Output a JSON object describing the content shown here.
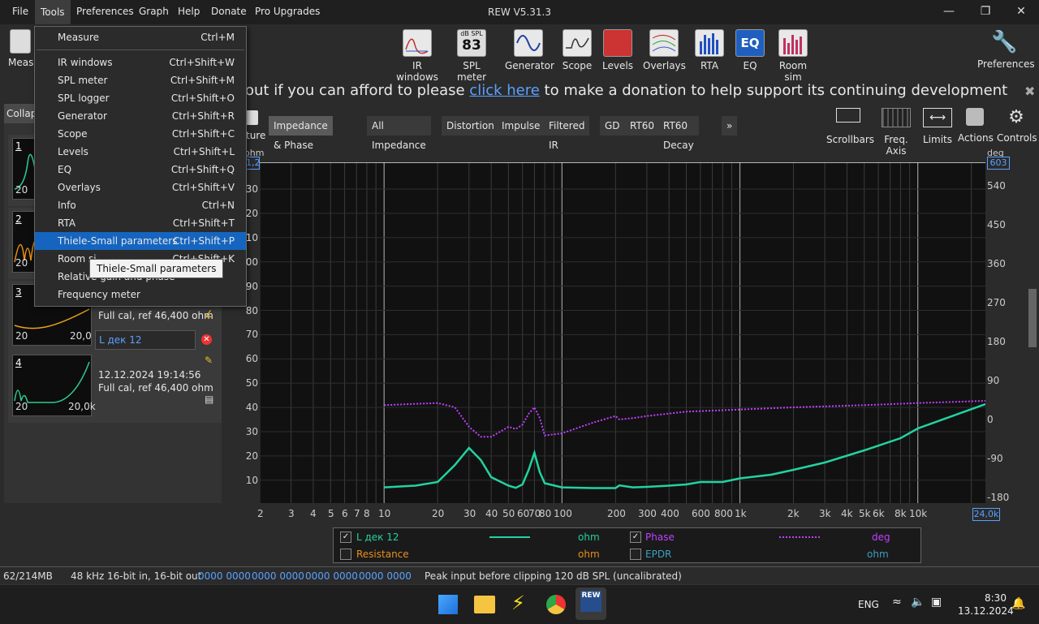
{
  "menubar": {
    "items": [
      "File",
      "Tools",
      "Preferences",
      "Graph",
      "Help",
      "Donate",
      "Pro Upgrades"
    ],
    "title": "REW V5.31.3"
  },
  "toolbar": {
    "left_label": "Meas",
    "buttons": [
      "IR windows",
      "SPL meter",
      "Generator",
      "Scope",
      "Levels",
      "Overlays",
      "RTA",
      "EQ",
      "Room sim"
    ],
    "spl_icon_top": "dB SPL",
    "spl_icon_value": "83",
    "eq_icon_text": "EQ",
    "preferences": "Preferences"
  },
  "donation": {
    "prefix": "out if you can afford to please ",
    "link": "click here",
    "suffix": " to make a donation to help support its continuing development"
  },
  "panel": {
    "collapse_label": "Collap",
    "capture_label": "ture",
    "measurements": [
      {
        "num": "1",
        "x_start": "20",
        "accent": "#2ecc8f"
      },
      {
        "num": "2",
        "x_start": "20",
        "accent": "#e8901a"
      },
      {
        "num": "3",
        "x_start": "20",
        "x_end": "20,0",
        "accent": "#e8a01a",
        "info": "Full cal, ref 46,400 ohm"
      },
      {
        "num": "4",
        "x_start": "20",
        "x_end": "20,0k",
        "accent": "#2ecc8f",
        "name": "L дек 12",
        "date": "12.12.2024 19:14:56",
        "info": "Full cal, ref 46,400 ohm"
      }
    ]
  },
  "tabs": [
    "Impedance & Phase",
    "All Impedance",
    "Distortion",
    "Impulse",
    "Filtered IR",
    "GD",
    "RT60",
    "RT60 Decay",
    "»"
  ],
  "right_tools": [
    "Scrollbars",
    "Freq. Axis",
    "Limits",
    "Actions",
    "Controls"
  ],
  "graph": {
    "left_unit": "ohm",
    "right_unit": "deg",
    "left_top_box": "1,2",
    "right_top_box": "603",
    "x_right_box": "24,0k",
    "left_ticks": [
      "30",
      "20",
      "10",
      "00",
      "90",
      "80",
      "70",
      "60",
      "50",
      "40",
      "30",
      "20",
      "10"
    ],
    "right_ticks": [
      "540",
      "450",
      "360",
      "270",
      "180",
      "90",
      "0",
      "-90",
      "-180"
    ],
    "x_ticks": [
      "2",
      "3",
      "4",
      "5",
      "6",
      "7",
      "8",
      "10",
      "20",
      "30",
      "40",
      "50",
      "60",
      "70",
      "80",
      "100",
      "200",
      "300",
      "400",
      "600",
      "800",
      "1k",
      "2k",
      "3k",
      "4k",
      "5k",
      "6k",
      "8k",
      "10k"
    ]
  },
  "chart_data": {
    "type": "line",
    "x_scale": "log",
    "xlim": [
      2,
      24000
    ],
    "series": [
      {
        "name": "L дек 12",
        "unit": "ohm",
        "color": "#22d3a0",
        "x": [
          10,
          15,
          20,
          25,
          30,
          35,
          40,
          50,
          55,
          60,
          65,
          70,
          75,
          80,
          100,
          150,
          200,
          210,
          250,
          300,
          400,
          500,
          600,
          800,
          1000,
          1500,
          2000,
          3000,
          5000,
          8000,
          10000,
          24000
        ],
        "y": [
          6.8,
          7.5,
          9,
          16,
          23,
          18,
          11,
          7.5,
          6.6,
          8,
          14,
          21,
          13,
          8.5,
          6.8,
          6.5,
          6.5,
          7.6,
          6.8,
          7,
          7.5,
          8,
          9,
          9,
          10.5,
          12,
          14,
          17,
          22,
          27,
          31,
          41
        ]
      },
      {
        "name": "Phase",
        "unit": "deg",
        "color": "#c040ff",
        "style": "dotted",
        "x": [
          10,
          15,
          20,
          25,
          30,
          35,
          40,
          50,
          55,
          60,
          65,
          70,
          75,
          80,
          100,
          150,
          200,
          210,
          250,
          300,
          500,
          1000,
          2000,
          5000,
          10000,
          24000
        ],
        "y": [
          35,
          38,
          40,
          30,
          -15,
          -38,
          -38,
          -15,
          -20,
          -10,
          15,
          30,
          5,
          -35,
          -30,
          -5,
          10,
          2,
          5,
          10,
          20,
          25,
          30,
          35,
          40,
          45
        ]
      }
    ],
    "legend_extra": [
      "Resistance",
      "EPDR"
    ]
  },
  "legend": {
    "row1": {
      "name": "L дек 12",
      "unit": "ohm",
      "name2": "Phase",
      "unit2": "deg"
    },
    "row2": {
      "name": "Resistance",
      "unit": "ohm",
      "name2": "EPDR",
      "unit2": "ohm"
    }
  },
  "menu": {
    "items": [
      {
        "label": "Measure",
        "shortcut": "Ctrl+M"
      },
      {
        "label": "IR windows",
        "shortcut": "Ctrl+Shift+W"
      },
      {
        "label": "SPL meter",
        "shortcut": "Ctrl+Shift+M"
      },
      {
        "label": "SPL logger",
        "shortcut": "Ctrl+Shift+O"
      },
      {
        "label": "Generator",
        "shortcut": "Ctrl+Shift+R"
      },
      {
        "label": "Scope",
        "shortcut": "Ctrl+Shift+C"
      },
      {
        "label": "Levels",
        "shortcut": "Ctrl+Shift+L"
      },
      {
        "label": "EQ",
        "shortcut": "Ctrl+Shift+Q"
      },
      {
        "label": "Overlays",
        "shortcut": "Ctrl+Shift+V"
      },
      {
        "label": "Info",
        "shortcut": "Ctrl+N"
      },
      {
        "label": "RTA",
        "shortcut": "Ctrl+Shift+T"
      },
      {
        "label": "Thiele-Small parameters",
        "shortcut": "Ctrl+Shift+P"
      },
      {
        "label": "Room si",
        "shortcut": "Ctrl+Shift+K"
      },
      {
        "label": "Relative gain and phase",
        "shortcut": ""
      },
      {
        "label": "Frequency meter",
        "shortcut": ""
      }
    ],
    "tooltip": "Thiele-Small parameters"
  },
  "status": {
    "memory": "62/214MB",
    "rate": "48 kHz",
    "bits": "16-bit in, 16-bit out",
    "hex": [
      "0000 0000",
      "0000 0000",
      "0000 0000",
      "0000 0000"
    ],
    "message": "Peak input before clipping 120 dB SPL (uncalibrated)"
  },
  "taskbar": {
    "lang": "ENG",
    "time": "8:30",
    "date": "13.12.2024",
    "rew_label": "REW"
  }
}
